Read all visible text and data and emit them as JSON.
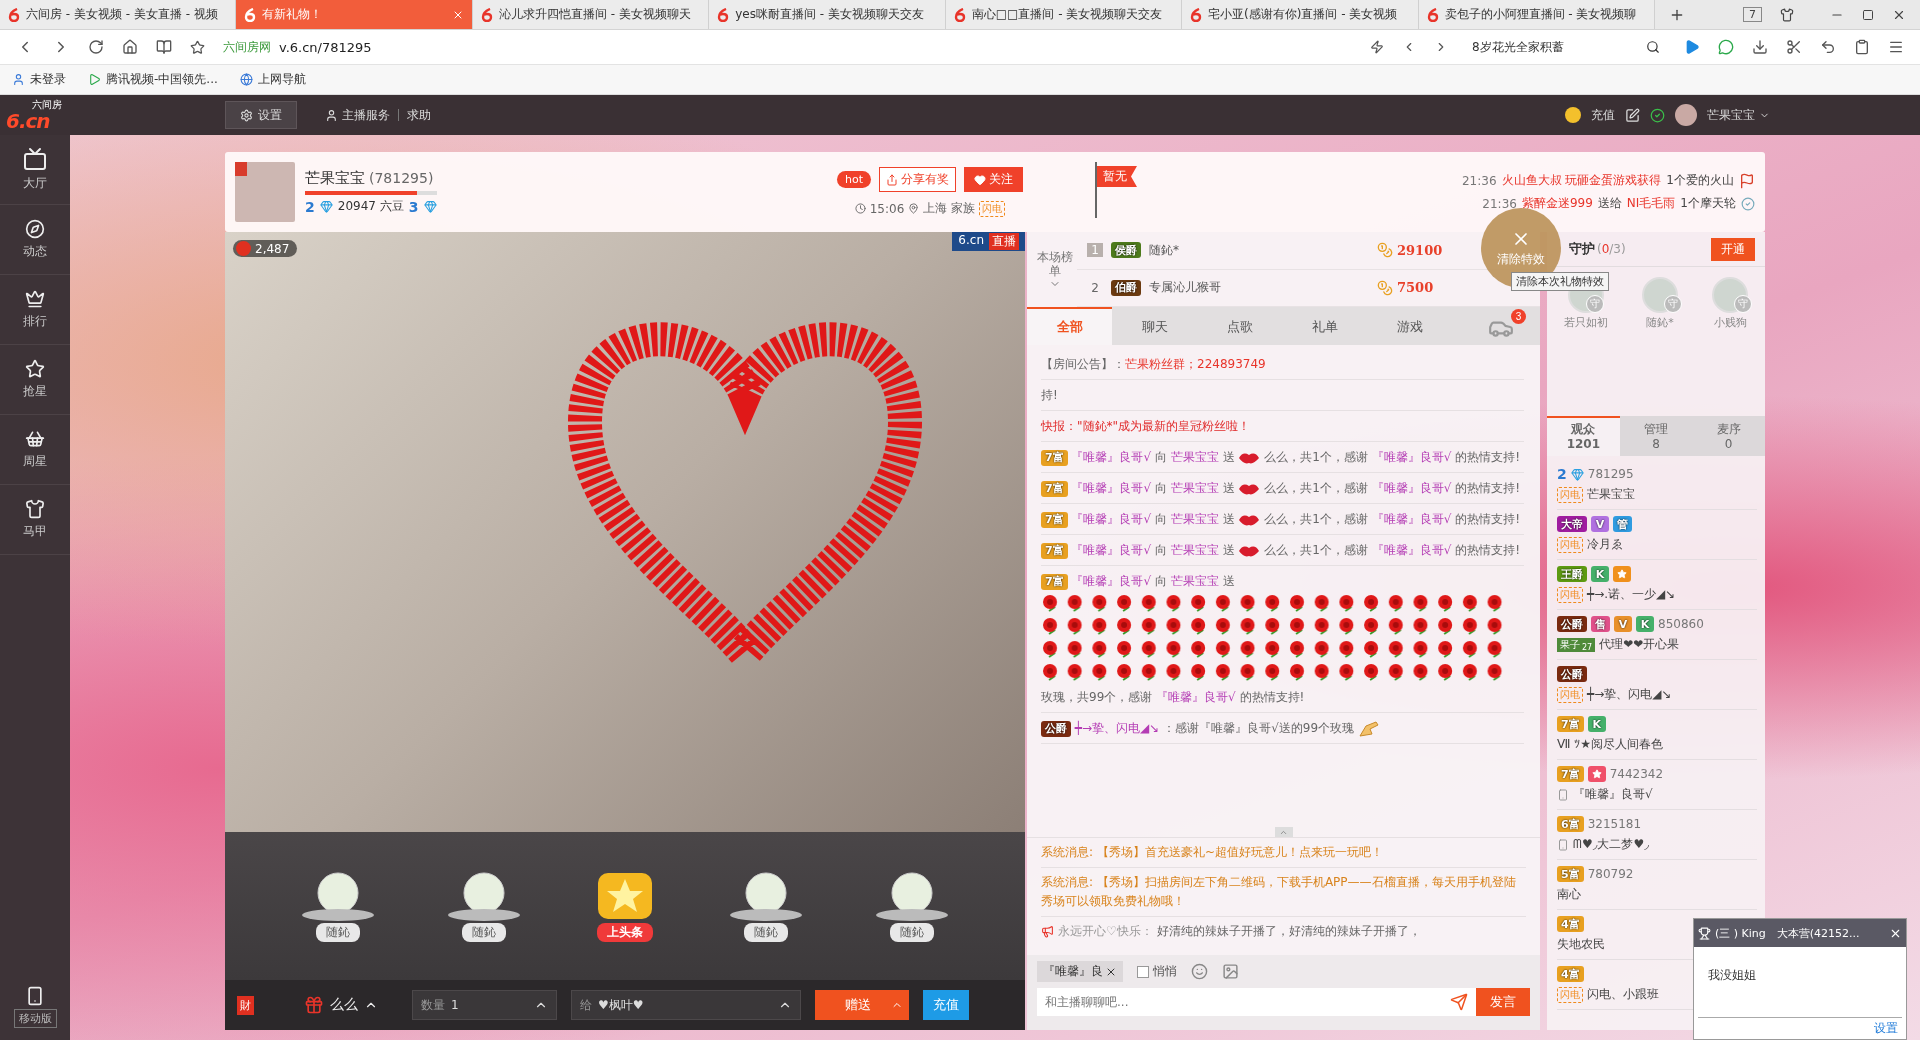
{
  "browser": {
    "tabs": [
      {
        "title": "六间房 - 美女视频 - 美女直播 - 视频",
        "selected": false
      },
      {
        "title": "有新礼物！",
        "selected": true
      },
      {
        "title": "沁儿求升四恺直播间 - 美女视频聊天",
        "selected": false
      },
      {
        "title": "yes咪耐直播间 - 美女视频聊天交友",
        "selected": false
      },
      {
        "title": "南心□□直播间 - 美女视频聊天交友",
        "selected": false
      },
      {
        "title": "宅小亚(感谢有你)直播间 - 美女视频",
        "selected": false
      },
      {
        "title": "卖包子的小阿狸直播间 - 美女视频聊",
        "selected": false
      }
    ],
    "tab_count": "7",
    "site": "六间房网",
    "url": "v.6.cn/781295",
    "search": "8岁花光全家积蓄",
    "bookmarks": [
      {
        "kind": "user",
        "label": "未登录"
      },
      {
        "kind": "video",
        "label": "腾讯视频-中国领先..."
      },
      {
        "kind": "web",
        "label": "上网导航"
      }
    ]
  },
  "site_header": {
    "logo": "6.cn",
    "logo_sub": "六间房",
    "settings": "设置",
    "service": "主播服务",
    "help": "求助",
    "recharge": "充值",
    "username": "芒果宝宝"
  },
  "sidebar": {
    "items": [
      {
        "kind": "tv",
        "label": "大厅"
      },
      {
        "kind": "compass",
        "label": "动态"
      },
      {
        "kind": "crown",
        "label": "排行"
      },
      {
        "kind": "star",
        "label": "抢星"
      },
      {
        "kind": "basket",
        "label": "周星"
      },
      {
        "kind": "shirt",
        "label": "马甲"
      }
    ],
    "mobile": "移动版"
  },
  "room": {
    "name": "芒果宝宝",
    "id": "(781295)",
    "level": 0.85,
    "wealth_level": "2",
    "beans": "20947 六豆",
    "star_level": "3",
    "hot": "hot",
    "share": "分享有奖",
    "follow": "关注",
    "time": "15:06",
    "location": "上海",
    "family_label": "家族",
    "family_tag": "闪电",
    "flag": "暂无",
    "ticker": [
      {
        "time": "21:36",
        "parts": [
          {
            "text": "火山鱼大叔 玩砸金蛋游戏获得",
            "highlight": true
          },
          {
            "text": "1个爱的火山",
            "highlight": false
          }
        ]
      },
      {
        "time": "21:36",
        "parts": [
          {
            "text": "紫醉金迷999",
            "highlight": true
          },
          {
            "text": "送给",
            "highlight": false
          },
          {
            "text": "NI毛毛雨",
            "highlight": true
          },
          {
            "text": "1个摩天轮",
            "highlight": false
          }
        ]
      }
    ]
  },
  "video": {
    "count": "2,487",
    "logo": "6.cn",
    "live": "直播"
  },
  "gifts": [
    {
      "kind": "trophy",
      "label": "随鈊"
    },
    {
      "kind": "trophy",
      "label": "随鈊"
    },
    {
      "kind": "headline",
      "label": "上头条"
    },
    {
      "kind": "trophy",
      "label": "随鈊"
    },
    {
      "kind": "trophy",
      "label": "随鈊"
    }
  ],
  "bottom_bar": {
    "wealth": "財",
    "gift": "么么",
    "quantity_label": "数量",
    "quantity": "1",
    "to_label": "给",
    "to": "♥枫叶♥",
    "give": "赠送",
    "recharge": "充值"
  },
  "ranking": {
    "title": "本场榜单",
    "rows": [
      {
        "rank": "1",
        "badge": {
          "text": "侯爵",
          "color": "#4d7a1c"
        },
        "name": "随鈊*",
        "score": "29100"
      },
      {
        "rank": "2",
        "badge": {
          "text": "伯爵",
          "color": "#6b3a10"
        },
        "name": "专属沁儿猴哥",
        "score": "7500"
      }
    ]
  },
  "clear_effects": {
    "label": "清除特效",
    "tooltip": "清除本次礼物特效"
  },
  "chat": {
    "tabs": [
      {
        "label": "全部",
        "selected": true
      },
      {
        "label": "聊天",
        "selected": false
      },
      {
        "label": "点歌",
        "selected": false
      },
      {
        "label": "礼单",
        "selected": false
      },
      {
        "label": "游戏",
        "selected": false
      }
    ],
    "car_badge": "3",
    "messages": [
      {
        "kind": "notice",
        "label": "【房间公告】：",
        "text": "芒果粉丝群；224893749"
      },
      {
        "kind": "plain",
        "text": "持!"
      },
      {
        "kind": "flash",
        "text": "快报：\"随鈊*\"成为最新的皇冠粉丝啦！"
      },
      {
        "kind": "gift",
        "badge": {
          "text": "7富",
          "color": "#e8a020"
        },
        "sender": "『唯馨』良哥√",
        "to": "向",
        "receiver": "芒果宝宝",
        "verb": "送",
        "tail": "么么，共1个，感谢",
        "thanker": "『唯馨』良哥√",
        "end": "的热情支持!"
      },
      {
        "kind": "gift",
        "badge": {
          "text": "7富",
          "color": "#e8a020"
        },
        "sender": "『唯馨』良哥√",
        "to": "向",
        "receiver": "芒果宝宝",
        "verb": "送",
        "tail": "么么，共1个，感谢",
        "thanker": "『唯馨』良哥√",
        "end": "的热情支持!"
      },
      {
        "kind": "gift",
        "badge": {
          "text": "7富",
          "color": "#e8a020"
        },
        "sender": "『唯馨』良哥√",
        "to": "向",
        "receiver": "芒果宝宝",
        "verb": "送",
        "tail": "么么，共1个，感谢",
        "thanker": "『唯馨』良哥√",
        "end": "的热情支持!"
      },
      {
        "kind": "gift",
        "badge": {
          "text": "7富",
          "color": "#e8a020"
        },
        "sender": "『唯馨』良哥√",
        "to": "向",
        "receiver": "芒果宝宝",
        "verb": "送",
        "tail": "么么，共1个，感谢",
        "thanker": "『唯馨』良哥√",
        "end": "的热情支持!"
      },
      {
        "kind": "roses",
        "badge": {
          "text": "7富",
          "color": "#e8a020"
        },
        "sender": "『唯馨』良哥√",
        "to": "向",
        "receiver": "芒果宝宝",
        "verb": "送",
        "tail": "玫瑰，共99个，感谢",
        "thanker": "『唯馨』良哥√",
        "end": "的热情支持!"
      },
      {
        "kind": "thanks",
        "badge": {
          "text": "公爵",
          "color": "#7a2a10"
        },
        "sender": "┿→挚、闪电◢↘",
        "text": "：感谢『唯馨』良哥√送的99个玫瑰"
      }
    ],
    "system": [
      {
        "label": "系统消息:",
        "text": "【秀场】首充送豪礼~超值好玩意儿！点来玩一玩吧！"
      },
      {
        "label": "系统消息:",
        "text": "【秀场】扫描房间左下角二维码，下载手机APP——石榴直播，每天用手机登陆秀场可以领取免费礼物哦！"
      }
    ],
    "broadcast": {
      "user": "永远开心♡快乐：",
      "text": "好清纯的辣妹子开播了，好清纯的辣妹子开播了，"
    },
    "reply_to": "『唯馨』良",
    "whisper": {
      "label": "悄悄",
      "checked": false
    },
    "placeholder": "和主播聊聊吧...",
    "send": "发言"
  },
  "guard": {
    "title": "守护",
    "count_open": "(",
    "count_current": "0",
    "count_close": "/3)",
    "open": "开通",
    "members": [
      {
        "name": "若只如初",
        "badge": "守"
      },
      {
        "name": "随鈊*",
        "badge": "守"
      },
      {
        "name": "小贱狗",
        "badge": "守"
      }
    ]
  },
  "audience": {
    "tabs": [
      {
        "label": "观众",
        "count": "1201",
        "selected": true
      },
      {
        "label": "管理",
        "count": "8",
        "selected": false
      },
      {
        "label": "麦序",
        "count": "0",
        "selected": false
      }
    ],
    "viewers": [
      {
        "level": "2",
        "number": "781295",
        "tag": {
          "kind": "flash",
          "text": "闪电"
        },
        "mobile": false,
        "name": "芒果宝宝"
      },
      {
        "badges": [
          {
            "kind": "label",
            "text": "大帝",
            "color": "#a01ca0"
          },
          {
            "kind": "label",
            "text": "V",
            "color": "#b070e0"
          },
          {
            "kind": "label",
            "text": "管",
            "color": "#2f9be0"
          }
        ],
        "tag": {
          "kind": "flash",
          "text": "闪电"
        },
        "mobile": false,
        "name": "冷月ゑ"
      },
      {
        "badges": [
          {
            "kind": "label",
            "text": "王爵",
            "color": "#5e9a12"
          },
          {
            "kind": "label",
            "text": "K",
            "color": "#45b06a"
          },
          {
            "kind": "star",
            "color": "#f0901c"
          }
        ],
        "tag": {
          "kind": "flash",
          "text": "闪电"
        },
        "mobile": false,
        "name": "┿→.诺、一少◢↘"
      },
      {
        "badges": [
          {
            "kind": "label",
            "text": "公爵",
            "color": "#7a2a10"
          },
          {
            "kind": "label",
            "text": "售",
            "color": "#e0508a"
          },
          {
            "kind": "label",
            "text": "V",
            "color": "#e8902a"
          },
          {
            "kind": "label",
            "text": "K",
            "color": "#45b06a"
          }
        ],
        "number": "850860",
        "tag": {
          "kind": "fan",
          "text": "果子",
          "count": "27"
        },
        "mobile": false,
        "name": "代理❤❤开心果"
      },
      {
        "badges": [
          {
            "kind": "label",
            "text": "公爵",
            "color": "#7a2a10"
          }
        ],
        "tag": {
          "kind": "flash",
          "text": "闪电"
        },
        "mobile": false,
        "name": "┿→挚、闪电◢↘"
      },
      {
        "badges": [
          {
            "kind": "label",
            "text": "7富",
            "color": "#e8a020"
          },
          {
            "kind": "label",
            "text": "K",
            "color": "#45b06a"
          }
        ],
        "mobile": false,
        "name": "Ⅶ ﾂ★阅尽人间春色"
      },
      {
        "badges": [
          {
            "kind": "label",
            "text": "7富",
            "color": "#e8a020"
          },
          {
            "kind": "star",
            "color": "#f0506a"
          }
        ],
        "number": "7442342",
        "mobile": true,
        "name": "『唯馨』良哥√"
      },
      {
        "badges": [
          {
            "kind": "label",
            "text": "6富",
            "color": "#e8a020"
          }
        ],
        "number": "3215181",
        "mobile": true,
        "name": "ᗰ♥◞大二梦♥◞"
      },
      {
        "badges": [
          {
            "kind": "label",
            "text": "5富",
            "color": "#e8a020"
          }
        ],
        "number": "780792",
        "mobile": false,
        "name": "南心"
      },
      {
        "badges": [
          {
            "kind": "label",
            "text": "4富",
            "color": "#e8a020"
          }
        ],
        "mobile": false,
        "name": "失地农民"
      },
      {
        "badges": [
          {
            "kind": "label",
            "text": "4富",
            "color": "#e8a020"
          }
        ],
        "tag": {
          "kind": "flash",
          "text": "闪电"
        },
        "mobile": false,
        "name": "闪电、小跟班"
      }
    ]
  },
  "popup": {
    "title": "(三 ) King　大本营(42152...",
    "message": "我没姐姐",
    "settings": "设置"
  }
}
